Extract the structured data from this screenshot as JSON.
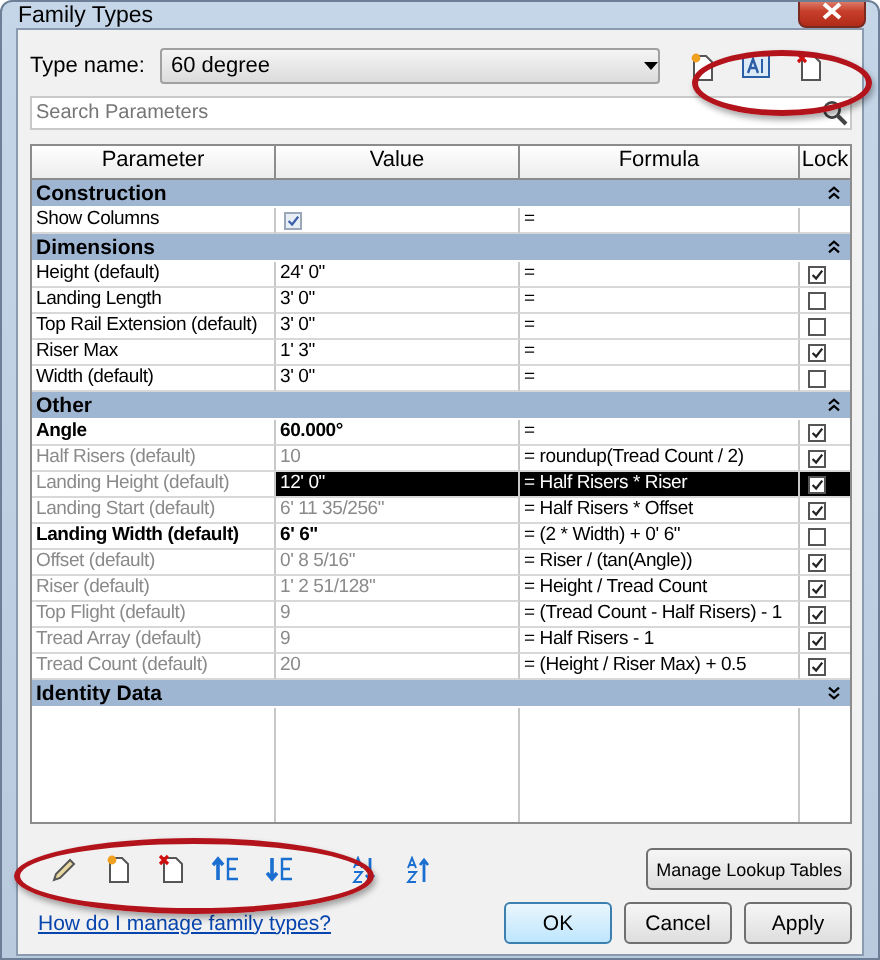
{
  "window": {
    "title": "Family Types"
  },
  "type_name": {
    "label": "Type name:",
    "value": "60 degree"
  },
  "search": {
    "placeholder": "Search Parameters"
  },
  "table": {
    "columns": [
      "Parameter",
      "Value",
      "Formula",
      "Lock"
    ],
    "groups": [
      {
        "name": "Construction",
        "expanded": true,
        "rows": [
          {
            "kind": "checkbox",
            "parameter": "Show Columns",
            "value_checked": true,
            "formula": "=",
            "bold": false,
            "disabled": false,
            "selected": false
          }
        ]
      },
      {
        "name": "Dimensions",
        "expanded": true,
        "rows": [
          {
            "kind": "text",
            "parameter": "Height (default)",
            "value": "24'  0\"",
            "formula": "=",
            "locked": true,
            "bold": false,
            "disabled": false,
            "selected": false
          },
          {
            "kind": "text",
            "parameter": "Landing Length",
            "value": "3'  0\"",
            "formula": "=",
            "locked": false,
            "bold": false,
            "disabled": false,
            "selected": false
          },
          {
            "kind": "text",
            "parameter": "Top Rail Extension (default)",
            "value": "3'  0\"",
            "formula": "=",
            "locked": false,
            "bold": false,
            "disabled": false,
            "selected": false
          },
          {
            "kind": "text",
            "parameter": "Riser Max",
            "value": "1'  3\"",
            "formula": "=",
            "locked": true,
            "bold": false,
            "disabled": false,
            "selected": false
          },
          {
            "kind": "text",
            "parameter": "Width (default)",
            "value": "3'  0\"",
            "formula": "=",
            "locked": false,
            "bold": false,
            "disabled": false,
            "selected": false
          }
        ]
      },
      {
        "name": "Other",
        "expanded": true,
        "rows": [
          {
            "kind": "text",
            "parameter": "Angle",
            "value": "60.000°",
            "formula": "=",
            "locked": true,
            "bold": true,
            "disabled": false,
            "selected": false
          },
          {
            "kind": "text",
            "parameter": "Half Risers (default)",
            "value": "10",
            "formula": "= roundup(Tread Count / 2)",
            "locked": true,
            "bold": false,
            "disabled": true,
            "selected": false
          },
          {
            "kind": "text",
            "parameter": "Landing Height (default)",
            "value": "12'  0\"",
            "formula": "= Half Risers * Riser",
            "locked": true,
            "bold": false,
            "disabled": true,
            "selected": true
          },
          {
            "kind": "text",
            "parameter": "Landing Start (default)",
            "value": "6'  11 35/256\"",
            "formula": "= Half Risers * Offset",
            "locked": true,
            "bold": false,
            "disabled": true,
            "selected": false
          },
          {
            "kind": "text",
            "parameter": "Landing Width (default)",
            "value": "6'  6\"",
            "formula": "= (2 * Width) + 0'  6\"",
            "locked": false,
            "bold": true,
            "disabled": false,
            "selected": false
          },
          {
            "kind": "text",
            "parameter": "Offset (default)",
            "value": "0'  8 5/16\"",
            "formula": "= Riser / (tan(Angle))",
            "locked": true,
            "bold": false,
            "disabled": true,
            "selected": false
          },
          {
            "kind": "text",
            "parameter": "Riser (default)",
            "value": "1'  2 51/128\"",
            "formula": "= Height / Tread Count",
            "locked": true,
            "bold": false,
            "disabled": true,
            "selected": false
          },
          {
            "kind": "text",
            "parameter": "Top Flight (default)",
            "value": "9",
            "formula": "= (Tread Count - Half Risers) - 1",
            "locked": true,
            "bold": false,
            "disabled": true,
            "selected": false
          },
          {
            "kind": "text",
            "parameter": "Tread Array (default)",
            "value": "9",
            "formula": "= Half Risers - 1",
            "locked": true,
            "bold": false,
            "disabled": true,
            "selected": false
          },
          {
            "kind": "text",
            "parameter": "Tread Count (default)",
            "value": "20",
            "formula": "= (Height / Riser Max) + 0.5",
            "locked": true,
            "bold": false,
            "disabled": true,
            "selected": false
          }
        ]
      },
      {
        "name": "Identity Data",
        "expanded": false
      }
    ]
  },
  "lookup_button": "Manage Lookup Tables",
  "help_link": "How do I manage family types?",
  "buttons": [
    "OK",
    "Cancel",
    "Apply"
  ]
}
